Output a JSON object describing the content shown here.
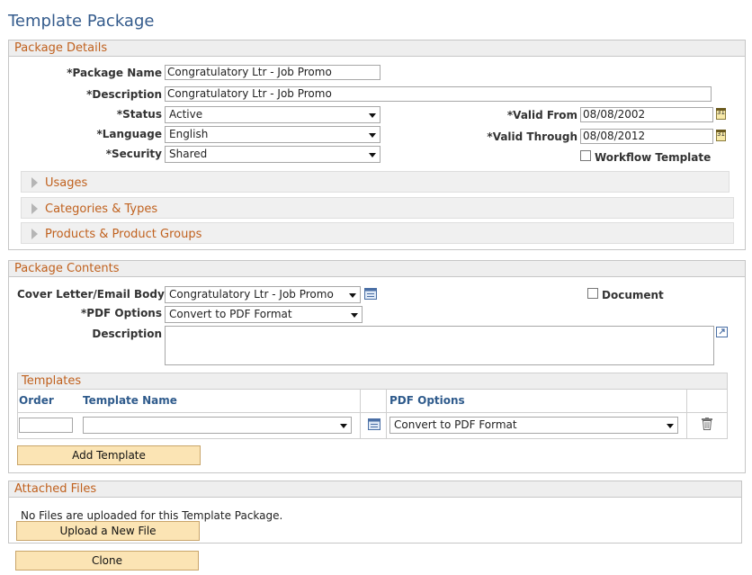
{
  "page": {
    "title": "Template Package"
  },
  "package_details": {
    "heading": "Package Details",
    "package_name": {
      "label": "*Package Name",
      "value": "Congratulatory Ltr - Job Promo"
    },
    "description": {
      "label": "*Description",
      "value": "Congratulatory Ltr - Job Promo"
    },
    "status": {
      "label": "*Status",
      "value": "Active"
    },
    "language": {
      "label": "*Language",
      "value": "English"
    },
    "security": {
      "label": "*Security",
      "value": "Shared"
    },
    "valid_from": {
      "label": "*Valid From",
      "value": "08/08/2002"
    },
    "valid_through": {
      "label": "*Valid Through",
      "value": "08/08/2012"
    },
    "workflow_template": {
      "label": "Workflow Template",
      "checked": false
    },
    "collapsibles": [
      "Usages",
      "Categories & Types",
      "Products & Product Groups"
    ]
  },
  "package_contents": {
    "heading": "Package Contents",
    "cover_letter": {
      "label": "Cover Letter/Email Body",
      "value": "Congratulatory Ltr - Job Promo"
    },
    "pdf_options": {
      "label": "*PDF Options",
      "value": "Convert to PDF Format"
    },
    "description": {
      "label": "Description",
      "value": ""
    },
    "document": {
      "label": "Document",
      "checked": false
    },
    "templates": {
      "heading": "Templates",
      "columns": {
        "order": "Order",
        "template_name": "Template Name",
        "pdf_options": "PDF Options"
      },
      "rows": [
        {
          "order": "",
          "template_name": "",
          "pdf_options": "Convert to PDF Format"
        }
      ]
    },
    "add_template_label": "Add Template"
  },
  "attached_files": {
    "heading": "Attached Files",
    "empty_message": "No Files are uploaded for this Template Package.",
    "upload_label": "Upload a New File"
  },
  "clone_label": "Clone",
  "colors": {
    "accent": "#c0611e",
    "title": "#345b8c",
    "button": "#fbe4b4"
  },
  "icons": {
    "calendar": "calendar-icon",
    "lookup": "lookup-icon",
    "expand": "expand-icon",
    "delete": "trash-icon"
  }
}
